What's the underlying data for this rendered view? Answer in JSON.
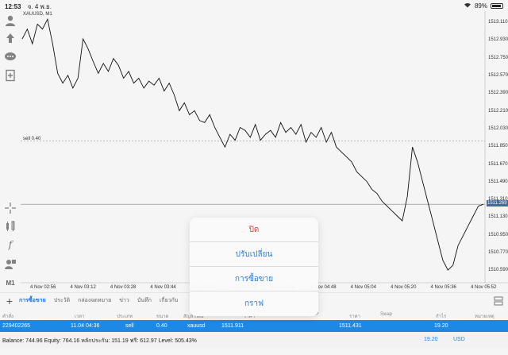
{
  "status_bar": {
    "time": "12:53",
    "date": "จ. 4 พ.ย.",
    "battery": "89%",
    "battery_level": 0.89
  },
  "chart": {
    "symbol_title": "XAUUSD, M1",
    "sell_line_label": "sell 0.40",
    "sell_level": 1511.911,
    "current_price": "1511.269",
    "current_price_value": 1511.269,
    "price_ticks": [
      "1513.110",
      "1512.930",
      "1512.750",
      "1512.570",
      "1512.390",
      "1512.210",
      "1512.030",
      "1511.850",
      "1511.670",
      "1511.490",
      "1511.310",
      "1511.130",
      "1510.950",
      "1510.770",
      "1510.590"
    ],
    "time_ticks": [
      "4 Nov 02:56",
      "4 Nov 03:12",
      "4 Nov 03:28",
      "4 Nov 03:44",
      "4 Nov 04:00",
      "4 Nov 04:16",
      "4 Nov 04:32",
      "4 Nov 04:48",
      "4 Nov 05:04",
      "4 Nov 05:20",
      "4 Nov 05:36",
      "4 Nov 05:52"
    ]
  },
  "chart_data": {
    "type": "line",
    "title": "XAUUSD, M1",
    "ylim": [
      1510.52,
      1513.2
    ],
    "x": [
      "02:50",
      "02:52",
      "02:54",
      "02:56",
      "02:58",
      "03:00",
      "03:02",
      "03:04",
      "03:06",
      "03:08",
      "03:10",
      "03:12",
      "03:14",
      "03:16",
      "03:18",
      "03:20",
      "03:22",
      "03:24",
      "03:26",
      "03:28",
      "03:30",
      "03:32",
      "03:34",
      "03:36",
      "03:38",
      "03:40",
      "03:42",
      "03:44",
      "03:46",
      "03:48",
      "03:50",
      "03:52",
      "03:54",
      "03:56",
      "03:58",
      "04:00",
      "04:02",
      "04:04",
      "04:06",
      "04:08",
      "04:10",
      "04:12",
      "04:14",
      "04:16",
      "04:18",
      "04:20",
      "04:22",
      "04:24",
      "04:26",
      "04:28",
      "04:30",
      "04:32",
      "04:34",
      "04:36",
      "04:38",
      "04:40",
      "04:42",
      "04:44",
      "04:46",
      "04:48",
      "04:50",
      "04:52",
      "04:54",
      "04:56",
      "04:58",
      "05:00",
      "05:02",
      "05:04",
      "05:06",
      "05:08",
      "05:10",
      "05:12",
      "05:14",
      "05:16",
      "05:18",
      "05:20",
      "05:22",
      "05:24",
      "05:26",
      "05:28",
      "05:30",
      "05:32",
      "05:34",
      "05:36",
      "05:38",
      "05:40",
      "05:42",
      "05:44",
      "05:46",
      "05:48",
      "05:50",
      "05:52"
    ],
    "values": [
      1512.95,
      1513.05,
      1512.9,
      1513.1,
      1513.05,
      1513.15,
      1512.9,
      1512.6,
      1512.5,
      1512.58,
      1512.45,
      1512.55,
      1512.95,
      1512.85,
      1512.72,
      1512.6,
      1512.7,
      1512.62,
      1512.75,
      1512.68,
      1512.55,
      1512.62,
      1512.5,
      1512.55,
      1512.45,
      1512.52,
      1512.48,
      1512.55,
      1512.42,
      1512.5,
      1512.38,
      1512.22,
      1512.3,
      1512.18,
      1512.22,
      1512.12,
      1512.1,
      1512.18,
      1512.05,
      1511.95,
      1511.85,
      1511.98,
      1511.92,
      1512.05,
      1512.02,
      1511.95,
      1512.08,
      1511.92,
      1511.98,
      1512.02,
      1511.95,
      1512.1,
      1512.0,
      1512.05,
      1511.98,
      1512.08,
      1511.9,
      1512.0,
      1511.95,
      1512.05,
      1511.9,
      1512.0,
      1511.85,
      1511.8,
      1511.75,
      1511.7,
      1511.6,
      1511.55,
      1511.5,
      1511.42,
      1511.38,
      1511.3,
      1511.25,
      1511.2,
      1511.15,
      1511.1,
      1511.35,
      1511.85,
      1511.7,
      1511.5,
      1511.3,
      1511.1,
      1510.9,
      1510.7,
      1510.6,
      1510.65,
      1510.85,
      1510.95,
      1511.05,
      1511.15,
      1511.25,
      1511.269
    ]
  },
  "tools": [
    "account-icon",
    "trade-up-icon",
    "chat-icon",
    "add-document-icon",
    "crosshair-icon",
    "indicators-icon",
    "function-icon",
    "objects-icon"
  ],
  "timeframe": "M1",
  "tabs": {
    "plus": "+",
    "items": [
      "การซื้อขาย",
      "ประวัติ",
      "กล่องจดหมาย",
      "ข่าว",
      "บันทึก",
      "เกี่ยวกับ"
    ]
  },
  "table": {
    "headers": [
      "คำสั่ง",
      "เวลา",
      "ประเภท",
      "ขนาด",
      "สัญลักษณ์",
      "ราคา",
      "S / L",
      "T / P",
      "ราคา",
      "Swap",
      "กำไร",
      "หมายเหตุ"
    ],
    "row": {
      "order": "229402265",
      "time": "11.04 04:36",
      "type": "sell",
      "size": "0.40",
      "symbol": "xauusd",
      "open_price": "1511.911",
      "current_price": "1511.431",
      "profit": "19.20"
    }
  },
  "balance": {
    "text": "Balance: 744.96 Equity: 764.16 หลักประกัน: 151.19 ฟรี: 612.97 Level: 505.43%",
    "profit": "19.20",
    "currency": "USD"
  },
  "action_sheet": {
    "close": "ปิด",
    "modify": "ปรับเปลี่ยน",
    "trade": "การซื้อขาย",
    "chart": "กราฟ"
  },
  "colors": {
    "accent": "#1e88e5",
    "destructive": "#e53935",
    "price_tag": "#4a6fa5"
  }
}
